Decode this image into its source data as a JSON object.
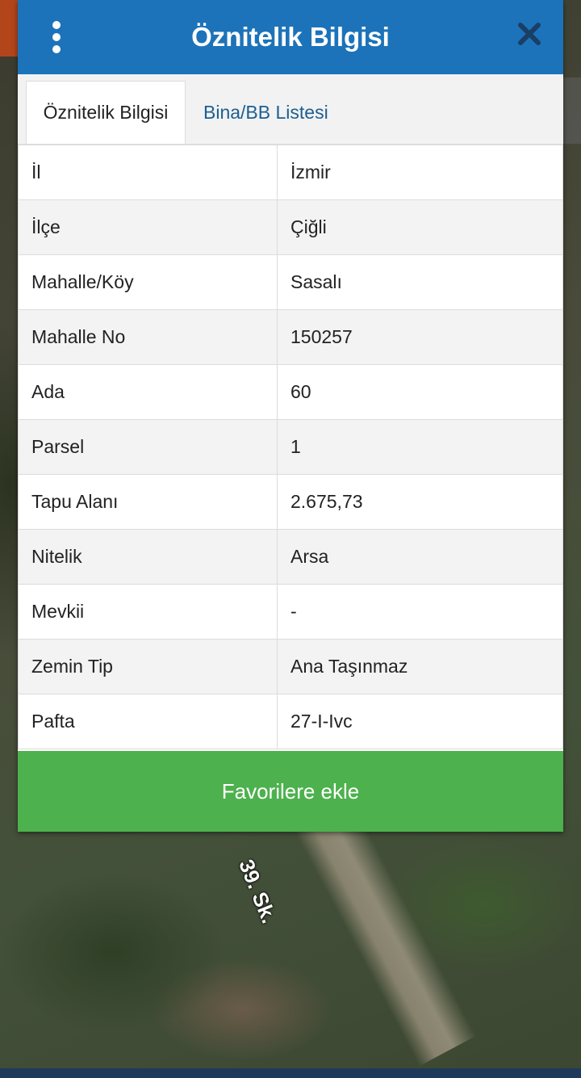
{
  "header": {
    "title": "Öznitelik Bilgisi",
    "menu_icon": "kebab-menu-icon",
    "close_icon": "close-icon"
  },
  "tabs": [
    {
      "label": "Öznitelik Bilgisi",
      "active": true
    },
    {
      "label": "Bina/BB Listesi",
      "active": false
    }
  ],
  "attributes": [
    {
      "key": "İl",
      "value": "İzmir"
    },
    {
      "key": "İlçe",
      "value": "Çiğli"
    },
    {
      "key": "Mahalle/Köy",
      "value": "Sasalı"
    },
    {
      "key": "Mahalle No",
      "value": "150257"
    },
    {
      "key": "Ada",
      "value": "60"
    },
    {
      "key": "Parsel",
      "value": "1"
    },
    {
      "key": "Tapu Alanı",
      "value": "2.675,73"
    },
    {
      "key": "Nitelik",
      "value": "Arsa"
    },
    {
      "key": "Mevkii",
      "value": "-"
    },
    {
      "key": "Zemin Tip",
      "value": "Ana Taşınmaz"
    },
    {
      "key": "Pafta",
      "value": "27-I-Ivc"
    }
  ],
  "favorite_button": {
    "label": "Favorilere ekle"
  },
  "map": {
    "street_label": "39. Sk."
  },
  "colors": {
    "header": "#1c73b9",
    "button": "#4db14d",
    "tab_link": "#1c5f92"
  }
}
